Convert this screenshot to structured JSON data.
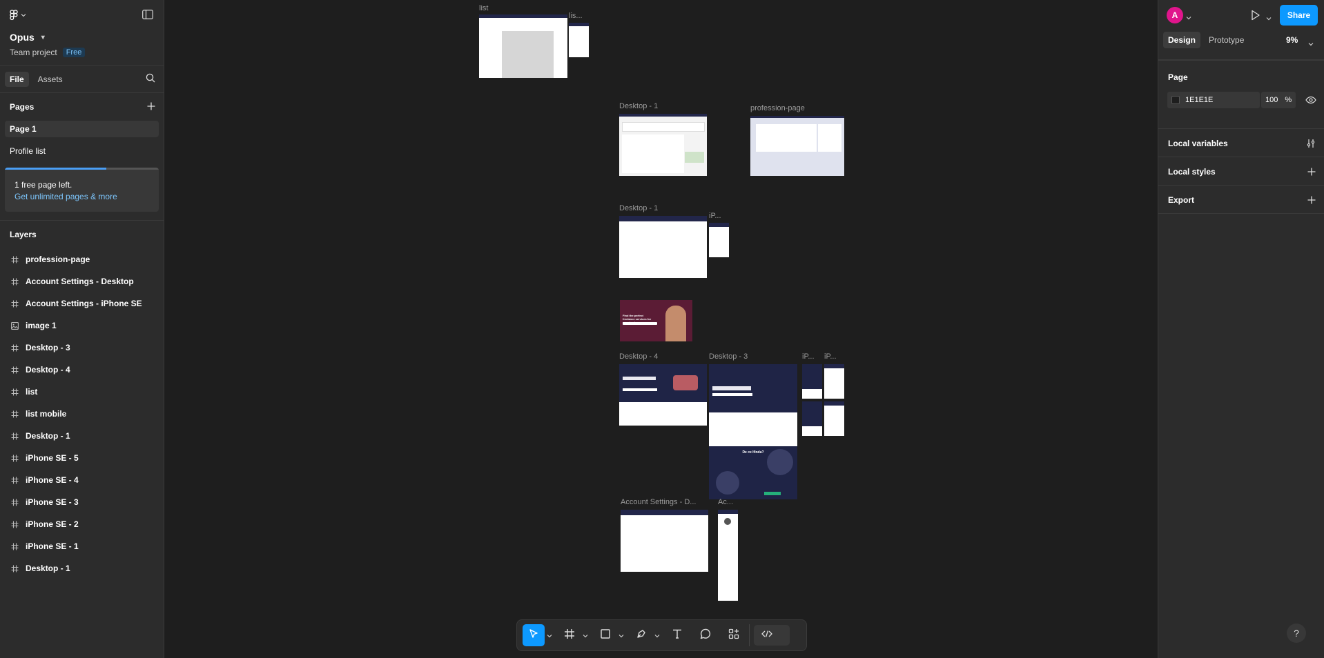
{
  "project": {
    "name": "Opus",
    "team": "Team project",
    "plan_badge": "Free"
  },
  "left_tabs": {
    "file": "File",
    "assets": "Assets"
  },
  "pages": {
    "title": "Pages",
    "items": [
      {
        "label": "Page 1"
      },
      {
        "label": "Profile list"
      }
    ]
  },
  "upsell": {
    "text": "1 free page left.",
    "link": "Get unlimited pages & more",
    "progress": 0.66
  },
  "layers": {
    "title": "Layers",
    "items": [
      {
        "label": "profession-page",
        "icon": "frame-icon"
      },
      {
        "label": "Account Settings - Desktop",
        "icon": "frame-icon"
      },
      {
        "label": "Account Settings - iPhone SE",
        "icon": "frame-icon"
      },
      {
        "label": "image 1",
        "icon": "image-icon"
      },
      {
        "label": "Desktop - 3",
        "icon": "frame-icon"
      },
      {
        "label": "Desktop - 4",
        "icon": "frame-icon"
      },
      {
        "label": "list",
        "icon": "frame-icon"
      },
      {
        "label": "list mobile",
        "icon": "frame-icon"
      },
      {
        "label": "Desktop - 1",
        "icon": "frame-icon"
      },
      {
        "label": "iPhone SE - 5",
        "icon": "frame-icon"
      },
      {
        "label": "iPhone SE - 4",
        "icon": "frame-icon"
      },
      {
        "label": "iPhone SE - 3",
        "icon": "frame-icon"
      },
      {
        "label": "iPhone SE - 2",
        "icon": "frame-icon"
      },
      {
        "label": "iPhone SE - 1",
        "icon": "frame-icon"
      },
      {
        "label": "Desktop - 1",
        "icon": "frame-icon"
      }
    ]
  },
  "right": {
    "avatar_initial": "A",
    "share": "Share",
    "tabs": {
      "design": "Design",
      "prototype": "Prototype"
    },
    "zoom": "9%",
    "page_section": {
      "title": "Page",
      "fill_hex": "1E1E1E",
      "opacity": "100",
      "opacity_unit": "%"
    },
    "local_variables": "Local variables",
    "local_styles": "Local styles",
    "export": "Export"
  },
  "canvas": {
    "labels": {
      "list": "list",
      "list_mobile": "lis...",
      "desktop1_a": "Desktop - 1",
      "profession": "profession-page",
      "desktop1_b": "Desktop - 1",
      "iphone_a": "iP...",
      "desktop4": "Desktop - 4",
      "desktop3": "Desktop - 3",
      "iphone_b": "iP...",
      "iphone_c": "iP...",
      "acct_desktop": "Account Settings - D...",
      "acct_iphone": "Ac..."
    },
    "hero_text": "Find the perfect freelance services for your business",
    "desktop3_heading": "De ce Ifinda?"
  },
  "toolbar": {
    "tools": [
      "move-tool",
      "frame-tool",
      "shape-tool",
      "pen-tool",
      "text-tool",
      "comment-tool",
      "actions-tool",
      "dev-mode-toggle"
    ]
  }
}
